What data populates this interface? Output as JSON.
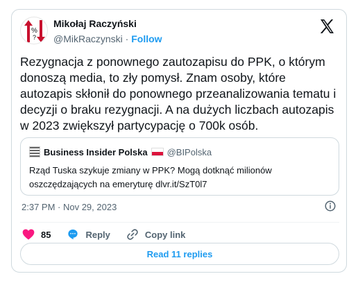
{
  "author": {
    "name": "Mikołaj Raczyński",
    "handle": "@MikRaczynski",
    "separator": "·",
    "follow_label": "Follow"
  },
  "tweet": {
    "text": "Rezygnacja z ponownego zautozapisu do PPK, o którym donoszą media, to zły pomysł. Znam osoby, które autozapis skłonił do ponownego przeanalizowania tematu i decyzji o braku rezygnacji. A na dużych liczbach autozapis w 2023 zwiększył partycypację o 700k osób."
  },
  "quote": {
    "name": "Business Insider Polska",
    "handle": "@BIPolska",
    "text": "Rząd Tuska szykuje zmiany w PPK? Mogą dotknąć milionów oszczędzających na emeryturę dlvr.it/SzT0l7"
  },
  "meta": {
    "timestamp": "2:37 PM · Nov 29, 2023"
  },
  "actions": {
    "like_count": "85",
    "reply_label": "Reply",
    "copy_link_label": "Copy link"
  },
  "footer": {
    "read_replies_label": "Read 11 replies"
  },
  "colors": {
    "accent": "#1d9bf0",
    "like": "#f91880",
    "secondary_text": "#536471"
  }
}
